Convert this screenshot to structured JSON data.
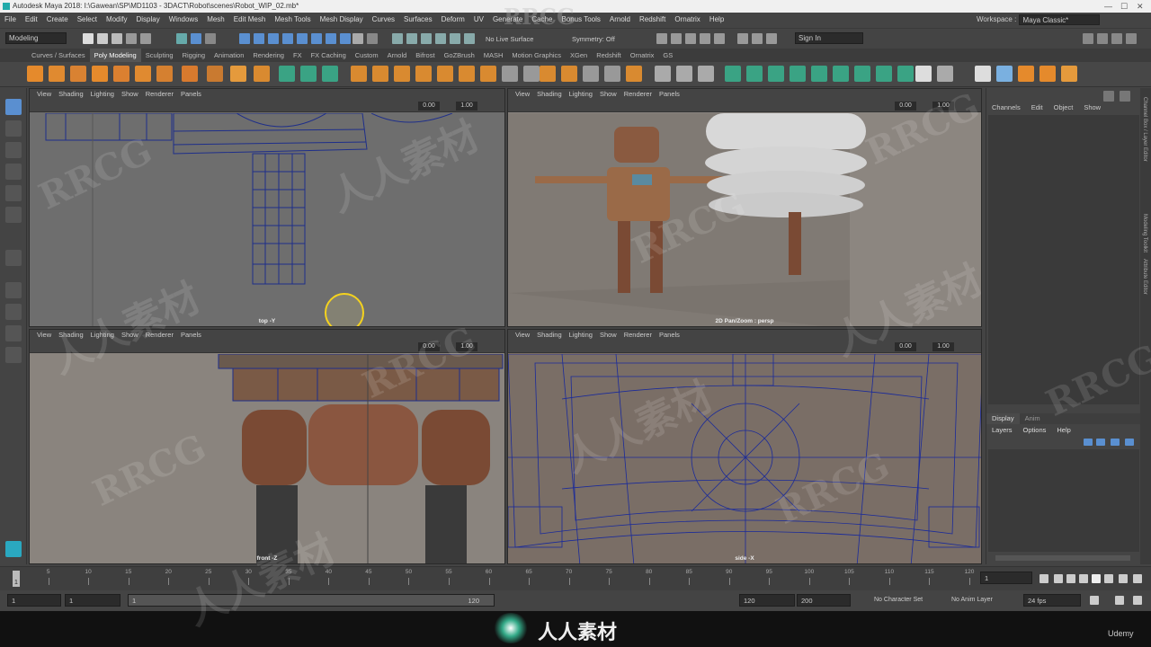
{
  "window": {
    "title": "Autodesk Maya 2018: I:\\Gawean\\SP\\MD1103 - 3DACT\\Robot\\scenes\\Robot_WIP_02.mb*",
    "controls": [
      "—",
      "☐",
      "✕"
    ]
  },
  "menu": [
    "File",
    "Edit",
    "Create",
    "Select",
    "Modify",
    "Display",
    "Windows",
    "Mesh",
    "Edit Mesh",
    "Mesh Tools",
    "Mesh Display",
    "Curves",
    "Surfaces",
    "Deform",
    "UV",
    "Generate",
    "Cache",
    "Bonus Tools",
    "Arnold",
    "Redshift",
    "Ornatrix",
    "Help"
  ],
  "workspace": {
    "label": "Workspace :",
    "value": "Maya Classic*"
  },
  "statusline": {
    "mode": "Modeling",
    "live_surface": "No Live Surface",
    "symmetry": "Symmetry: Off",
    "sign_in": "Sign In"
  },
  "shelf_tabs": [
    "Curves / Surfaces",
    "Poly Modeling",
    "Sculpting",
    "Rigging",
    "Animation",
    "Rendering",
    "FX",
    "FX Caching",
    "Custom",
    "Arnold",
    "Bifrost",
    "GoZBrush",
    "MASH",
    "Motion Graphics",
    "XGen",
    "Redshift",
    "Ornatrix",
    "GS"
  ],
  "shelf_active": "Poly Modeling",
  "panel_menu": [
    "View",
    "Shading",
    "Lighting",
    "Show",
    "Renderer",
    "Panels"
  ],
  "panes": [
    {
      "label": "top -Y",
      "val1": "0.00",
      "val2": "1.00"
    },
    {
      "label": "2D Pan/Zoom : persp",
      "val1": "0.00",
      "val2": "1.00"
    },
    {
      "label": "front -Z",
      "val1": "0.00",
      "val2": "1.00"
    },
    {
      "label": "side -X",
      "val1": "0.00",
      "val2": "1.00"
    }
  ],
  "channelbox": {
    "tabs": [
      "Channels",
      "Edit",
      "Object",
      "Show"
    ],
    "layer_tabs": [
      "Display",
      "Anim"
    ],
    "layer_menu": [
      "Layers",
      "Options",
      "Help"
    ]
  },
  "sidetabs": [
    "Channel Box / Layer Editor",
    "Modeling Toolkit",
    "Attribute Editor"
  ],
  "timeslider": {
    "ticks": [
      "5",
      "10",
      "15",
      "20",
      "25",
      "30",
      "35",
      "40",
      "45",
      "50",
      "55",
      "60",
      "65",
      "70",
      "75",
      "80",
      "85",
      "90",
      "95",
      "100",
      "105",
      "110",
      "115",
      "120"
    ],
    "current": "1",
    "start_mark": "1"
  },
  "range": {
    "start": "1",
    "anim_start": "1",
    "slider_start": "1",
    "slider_end": "120",
    "end": "120",
    "anim_end": "200",
    "character": "No Character Set",
    "anim_layer": "No Anim Layer",
    "fps": "24 fps"
  },
  "watermark": {
    "brand": "RRCG",
    "cn": "人人素材",
    "footer": "人人素材",
    "udemy": "Udemy"
  }
}
